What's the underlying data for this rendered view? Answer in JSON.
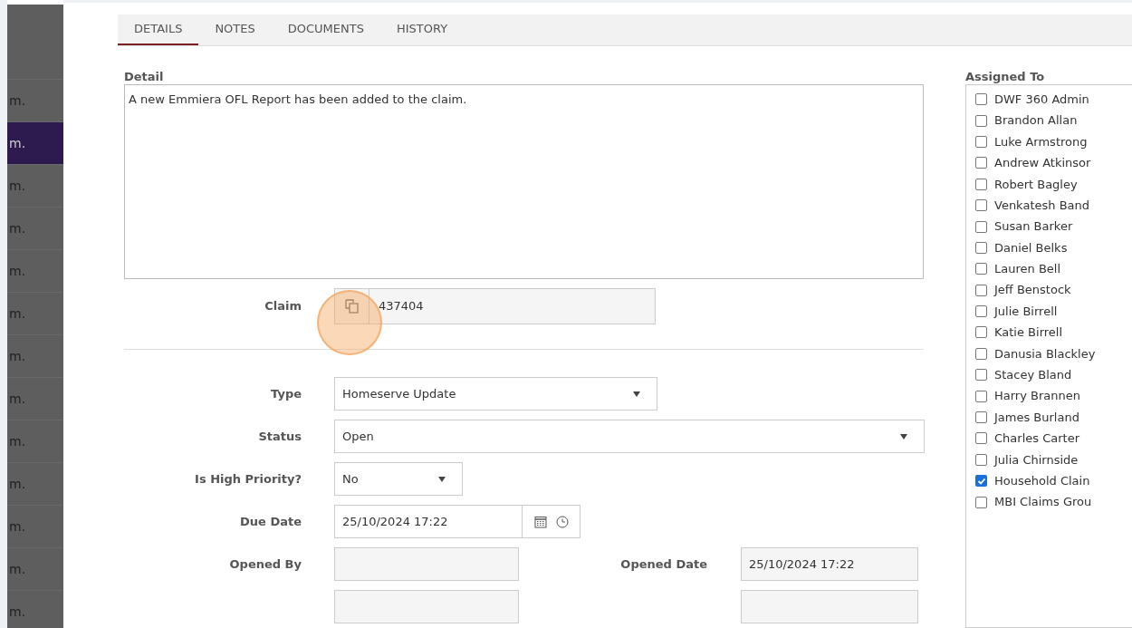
{
  "sidebar": {
    "items": [
      {
        "label": "m.",
        "selected": false
      },
      {
        "label": "m.",
        "selected": true
      },
      {
        "label": "m.",
        "selected": false
      },
      {
        "label": "m.",
        "selected": false
      },
      {
        "label": "m.",
        "selected": false
      },
      {
        "label": "m.",
        "selected": false
      },
      {
        "label": "m.",
        "selected": false
      },
      {
        "label": "m.",
        "selected": false
      },
      {
        "label": "m.",
        "selected": false
      },
      {
        "label": "m.",
        "selected": false
      },
      {
        "label": "m.",
        "selected": false
      },
      {
        "label": "m.",
        "selected": false
      },
      {
        "label": "m.",
        "selected": false
      }
    ]
  },
  "tabs": [
    {
      "label": "DETAILS",
      "selected": true
    },
    {
      "label": "NOTES",
      "selected": false
    },
    {
      "label": "DOCUMENTS",
      "selected": false
    },
    {
      "label": "HISTORY",
      "selected": false
    }
  ],
  "detail": {
    "label": "Detail",
    "value": "A new Emmiera OFL Report has been added to the claim."
  },
  "claim": {
    "label": "Claim",
    "value": "437404"
  },
  "fields": [
    {
      "kind": "select",
      "label": "Type",
      "value": "Homeserve Update"
    },
    {
      "kind": "select",
      "label": "Status",
      "value": "Open"
    },
    {
      "kind": "select",
      "label": "Is High Priority?",
      "value": "No"
    },
    {
      "kind": "datetime",
      "label": "Due Date",
      "value": "25/10/2024 17:22"
    },
    {
      "kind": "pair",
      "label": "Opened By",
      "label2": "Opened Date",
      "value2": "25/10/2024 17:22"
    }
  ],
  "assigned": {
    "label": "Assigned To",
    "items": [
      {
        "name": "DWF 360 Admin",
        "checked": false
      },
      {
        "name": "Brandon Allan",
        "checked": false
      },
      {
        "name": "Luke Armstrong",
        "checked": false
      },
      {
        "name": "Andrew Atkinsor",
        "checked": false
      },
      {
        "name": "Robert Bagley",
        "checked": false
      },
      {
        "name": "Venkatesh Band",
        "checked": false
      },
      {
        "name": "Susan Barker",
        "checked": false
      },
      {
        "name": "Daniel Belks",
        "checked": false
      },
      {
        "name": "Lauren Bell",
        "checked": false
      },
      {
        "name": "Jeff Benstock",
        "checked": false
      },
      {
        "name": "Julie Birrell",
        "checked": false
      },
      {
        "name": "Katie Birrell",
        "checked": false
      },
      {
        "name": "Danusia Blackley",
        "checked": false
      },
      {
        "name": "Stacey Bland",
        "checked": false
      },
      {
        "name": "Harry Brannen",
        "checked": false
      },
      {
        "name": "James Burland",
        "checked": false
      },
      {
        "name": "Charles Carter",
        "checked": false
      },
      {
        "name": "Julia Chirnside",
        "checked": false
      },
      {
        "name": "Household Clain",
        "checked": true
      },
      {
        "name": "MBI Claims Grou",
        "checked": false
      }
    ]
  }
}
